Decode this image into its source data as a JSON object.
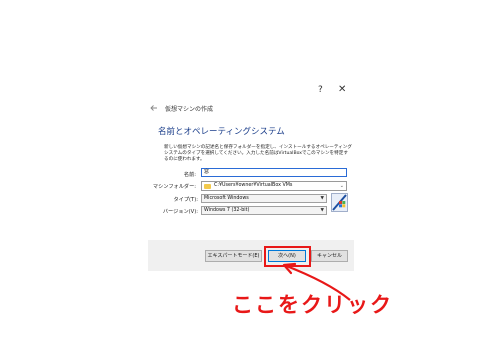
{
  "titlebar": {
    "help_label": "?",
    "close_label": "✕"
  },
  "wizard": {
    "title": "仮想マシンの作成",
    "section_heading": "名前とオペレーティングシステム",
    "description": "新しい仮想マシンの記述名と保存フォルダーを指定し、インストールするオペレーティングシステムのタイプを選択してください。入力した名前はVirtualBoxでこのマシンを特定するのに使われます。"
  },
  "form": {
    "name_label": "名前:",
    "name_value": "窓",
    "folder_label": "マシンフォルダー:",
    "folder_value": "C:¥Users¥owner¥VirtualBox VMs",
    "type_label": "タイプ(T):",
    "type_value": "Microsoft Windows",
    "version_label": "バージョン(V):",
    "version_value": "Windows 7 (32-bit)"
  },
  "buttons": {
    "expert_mode": "エキスパートモード(E)",
    "next": "次へ(N)",
    "cancel": "キャンセル"
  },
  "annotation": {
    "text": "ここをクリック"
  },
  "colors": {
    "highlight": "#e81818",
    "heading": "#1a3d8a",
    "focus": "#2a6bd6"
  },
  "icons": {
    "back": "back-arrow-icon",
    "folder": "folder-icon",
    "os": "windows-7-os-icon"
  }
}
